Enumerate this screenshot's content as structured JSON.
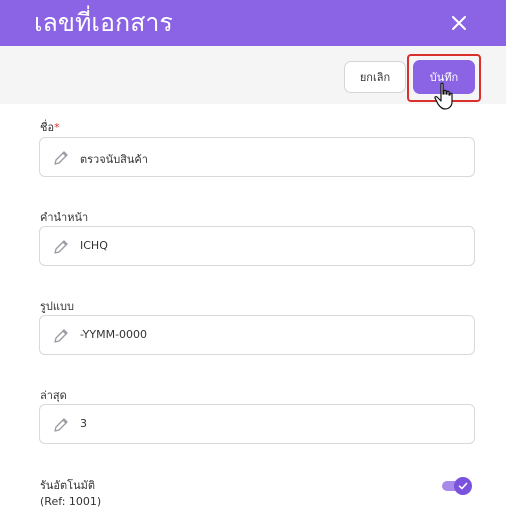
{
  "header": {
    "title": "เลขที่เอกสาร",
    "close_icon": "close-icon"
  },
  "toolbar": {
    "cancel_label": "ยกเลิก",
    "save_label": "บันทึก"
  },
  "fields": [
    {
      "label": "ชื่อ",
      "required_mark": "*",
      "value": "ตรวจนับสินค้า",
      "icon": "pencil-icon"
    },
    {
      "label": "คำนำหน้า",
      "value": "ICHQ",
      "icon": "pencil-icon"
    },
    {
      "label": "รูปแบบ",
      "value": "-YYMM-0000",
      "icon": "pencil-icon"
    },
    {
      "label": "ล่าสุด",
      "value": "3",
      "icon": "pencil-icon"
    }
  ],
  "auto_run": {
    "label": "รันอัตโนมัติ",
    "ref": "(Ref: 1001)",
    "enabled": true
  },
  "colors": {
    "accent": "#8a64e4",
    "highlight": "#d9302c",
    "toggle": "#7a52de"
  }
}
